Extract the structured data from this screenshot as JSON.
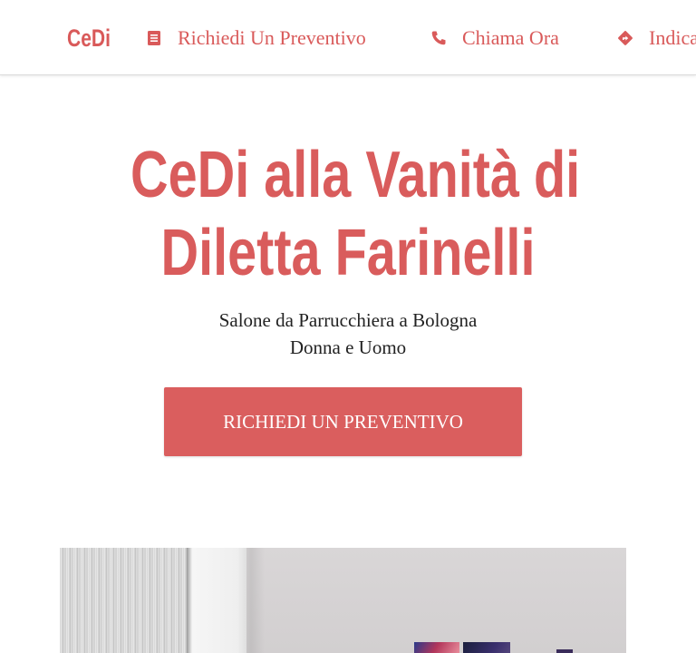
{
  "nav": {
    "brand": "CeDi",
    "links": [
      {
        "label": "Richiedi Un Preventivo",
        "icon": "document-icon"
      },
      {
        "label": "Chiama Ora",
        "icon": "phone-icon"
      },
      {
        "label": "Indicazioni",
        "icon": "directions-icon"
      }
    ]
  },
  "hero": {
    "title_line1": "CeDi alla Vanità di",
    "title_line2": "Diletta Farinelli",
    "subtitle_line1": "Salone da Parrucchiera a Bologna",
    "subtitle_line2": "Donna e Uomo",
    "cta_label": "RICHIEDI UN PREVENTIVO"
  },
  "colors": {
    "accent": "#d95a5a",
    "text": "#222222",
    "background": "#ffffff"
  }
}
